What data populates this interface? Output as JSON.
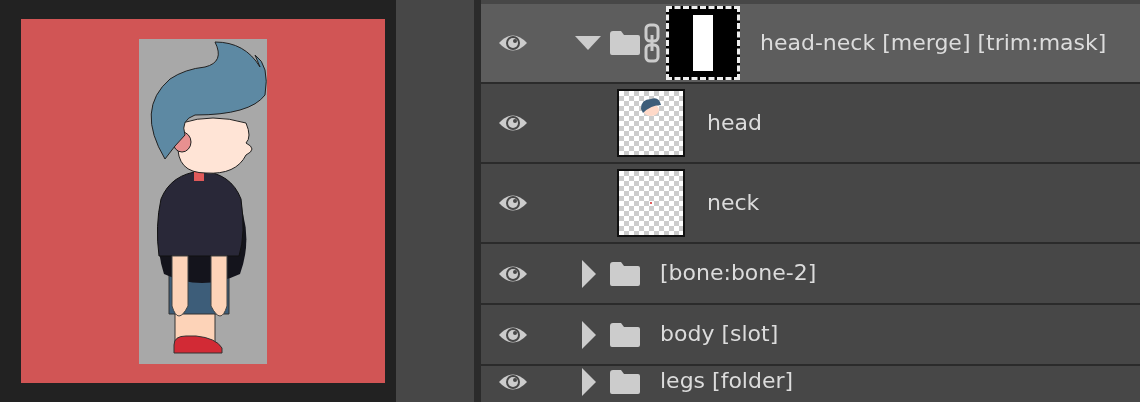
{
  "layers": [
    {
      "name": "head-neck [merge] [trim:mask]",
      "kind": "group",
      "visible": true,
      "expanded": true,
      "selected": true,
      "mask": true,
      "children": [
        {
          "name": "head",
          "kind": "layer",
          "visible": true,
          "selected": false
        },
        {
          "name": "neck",
          "kind": "layer",
          "visible": true,
          "selected": false
        }
      ]
    },
    {
      "name": "[bone:bone-2]",
      "kind": "group",
      "visible": true,
      "expanded": false,
      "selected": false,
      "mask": false
    },
    {
      "name": "body [slot]",
      "kind": "group",
      "visible": true,
      "expanded": false,
      "selected": false,
      "mask": false
    },
    {
      "name": "legs [folder]",
      "kind": "group",
      "visible": true,
      "expanded": false,
      "selected": false,
      "mask": false
    }
  ]
}
